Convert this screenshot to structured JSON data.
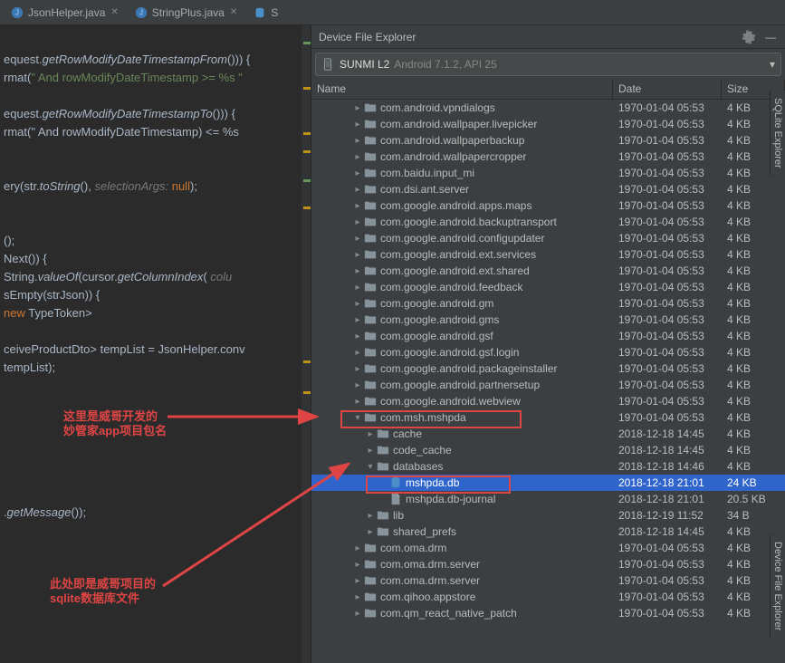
{
  "tabs": [
    {
      "label": "JsonHelper.java",
      "icon": "java"
    },
    {
      "label": "StringPlus.java",
      "icon": "java"
    },
    {
      "label": "S",
      "icon": "db"
    }
  ],
  "panel": {
    "title": "Device File Explorer",
    "device": "SUNMI L2",
    "device_detail": "Android 7.1.2, API 25"
  },
  "columns": {
    "name": "Name",
    "date": "Date",
    "size": "Size"
  },
  "annotations": {
    "a1_l1": "这里是威哥开发的",
    "a1_l2": "妙管家app项目包名",
    "a2_l1": "此处即是威哥项目的",
    "a2_l2": "sqlite数据库文件"
  },
  "side_tabs": {
    "sqlite": "SQLite Explorer",
    "dfe": "Device File Explorer"
  },
  "code": [
    "",
    "equest.getRowModifyDateTimestampFrom())) {",
    "rmat(\" And rowModifyDateTimestamp >= %s \"",
    "",
    "equest.getRowModifyDateTimestampTo())) {",
    "rmat(\" And rowModifyDateTimestamp) <= %s",
    "",
    "",
    "ery(str.toString(),  selectionArgs: null);",
    "",
    "",
    "<ShiftReceiveProductDto>();",
    "Next()) {",
    " String.valueOf(cursor.getColumnIndex( colu",
    "sEmpty(strJson)) {",
    " new TypeToken<List<ShiftReceiveProductDto>>",
    "",
    "ceiveProductDto> tempList = JsonHelper.conv",
    "tempList);",
    "",
    "",
    "",
    "",
    "",
    "",
    "",
    ".getMessage());",
    ""
  ],
  "files": [
    {
      "depth": 3,
      "arrow": "r",
      "icon": "folder",
      "name": "com.android.vpndialogs",
      "date": "1970-01-04 05:53",
      "size": "4 KB"
    },
    {
      "depth": 3,
      "arrow": "r",
      "icon": "folder",
      "name": "com.android.wallpaper.livepicker",
      "date": "1970-01-04 05:53",
      "size": "4 KB"
    },
    {
      "depth": 3,
      "arrow": "r",
      "icon": "folder",
      "name": "com.android.wallpaperbackup",
      "date": "1970-01-04 05:53",
      "size": "4 KB"
    },
    {
      "depth": 3,
      "arrow": "r",
      "icon": "folder",
      "name": "com.android.wallpapercropper",
      "date": "1970-01-04 05:53",
      "size": "4 KB"
    },
    {
      "depth": 3,
      "arrow": "r",
      "icon": "folder",
      "name": "com.baidu.input_mi",
      "date": "1970-01-04 05:53",
      "size": "4 KB"
    },
    {
      "depth": 3,
      "arrow": "r",
      "icon": "folder",
      "name": "com.dsi.ant.server",
      "date": "1970-01-04 05:53",
      "size": "4 KB"
    },
    {
      "depth": 3,
      "arrow": "r",
      "icon": "folder",
      "name": "com.google.android.apps.maps",
      "date": "1970-01-04 05:53",
      "size": "4 KB"
    },
    {
      "depth": 3,
      "arrow": "r",
      "icon": "folder",
      "name": "com.google.android.backuptransport",
      "date": "1970-01-04 05:53",
      "size": "4 KB"
    },
    {
      "depth": 3,
      "arrow": "r",
      "icon": "folder",
      "name": "com.google.android.configupdater",
      "date": "1970-01-04 05:53",
      "size": "4 KB"
    },
    {
      "depth": 3,
      "arrow": "r",
      "icon": "folder",
      "name": "com.google.android.ext.services",
      "date": "1970-01-04 05:53",
      "size": "4 KB"
    },
    {
      "depth": 3,
      "arrow": "r",
      "icon": "folder",
      "name": "com.google.android.ext.shared",
      "date": "1970-01-04 05:53",
      "size": "4 KB"
    },
    {
      "depth": 3,
      "arrow": "r",
      "icon": "folder",
      "name": "com.google.android.feedback",
      "date": "1970-01-04 05:53",
      "size": "4 KB"
    },
    {
      "depth": 3,
      "arrow": "r",
      "icon": "folder",
      "name": "com.google.android.gm",
      "date": "1970-01-04 05:53",
      "size": "4 KB"
    },
    {
      "depth": 3,
      "arrow": "r",
      "icon": "folder",
      "name": "com.google.android.gms",
      "date": "1970-01-04 05:53",
      "size": "4 KB"
    },
    {
      "depth": 3,
      "arrow": "r",
      "icon": "folder",
      "name": "com.google.android.gsf",
      "date": "1970-01-04 05:53",
      "size": "4 KB"
    },
    {
      "depth": 3,
      "arrow": "r",
      "icon": "folder",
      "name": "com.google.android.gsf.login",
      "date": "1970-01-04 05:53",
      "size": "4 KB"
    },
    {
      "depth": 3,
      "arrow": "r",
      "icon": "folder",
      "name": "com.google.android.packageinstaller",
      "date": "1970-01-04 05:53",
      "size": "4 KB"
    },
    {
      "depth": 3,
      "arrow": "r",
      "icon": "folder",
      "name": "com.google.android.partnersetup",
      "date": "1970-01-04 05:53",
      "size": "4 KB"
    },
    {
      "depth": 3,
      "arrow": "r",
      "icon": "folder",
      "name": "com.google.android.webview",
      "date": "1970-01-04 05:53",
      "size": "4 KB"
    },
    {
      "depth": 3,
      "arrow": "d",
      "icon": "folder",
      "name": "com.msh.mshpda",
      "date": "1970-01-04 05:53",
      "size": "4 KB",
      "boxed": 1
    },
    {
      "depth": 4,
      "arrow": "r",
      "icon": "folder",
      "name": "cache",
      "date": "2018-12-18 14:45",
      "size": "4 KB"
    },
    {
      "depth": 4,
      "arrow": "r",
      "icon": "folder",
      "name": "code_cache",
      "date": "2018-12-18 14:45",
      "size": "4 KB"
    },
    {
      "depth": 4,
      "arrow": "d",
      "icon": "folder",
      "name": "databases",
      "date": "2018-12-18 14:46",
      "size": "4 KB"
    },
    {
      "depth": 5,
      "arrow": "",
      "icon": "db",
      "name": "mshpda.db",
      "date": "2018-12-18 21:01",
      "size": "24 KB",
      "selected": true,
      "boxed": 2
    },
    {
      "depth": 5,
      "arrow": "",
      "icon": "file",
      "name": "mshpda.db-journal",
      "date": "2018-12-18 21:01",
      "size": "20.5 KB"
    },
    {
      "depth": 4,
      "arrow": "r",
      "icon": "folder",
      "name": "lib",
      "date": "2018-12-19 11:52",
      "size": "34 B"
    },
    {
      "depth": 4,
      "arrow": "r",
      "icon": "folder",
      "name": "shared_prefs",
      "date": "2018-12-18 14:45",
      "size": "4 KB"
    },
    {
      "depth": 3,
      "arrow": "r",
      "icon": "folder",
      "name": "com.oma.drm",
      "date": "1970-01-04 05:53",
      "size": "4 KB"
    },
    {
      "depth": 3,
      "arrow": "r",
      "icon": "folder",
      "name": "com.oma.drm.server",
      "date": "1970-01-04 05:53",
      "size": "4 KB"
    },
    {
      "depth": 3,
      "arrow": "r",
      "icon": "folder",
      "name": "com.oma.drm.server",
      "date": "1970-01-04 05:53",
      "size": "4 KB"
    },
    {
      "depth": 3,
      "arrow": "r",
      "icon": "folder",
      "name": "com.qihoo.appstore",
      "date": "1970-01-04 05:53",
      "size": "4 KB"
    },
    {
      "depth": 3,
      "arrow": "r",
      "icon": "folder",
      "name": "com.qm_react_native_patch",
      "date": "1970-01-04 05:53",
      "size": "4 KB"
    }
  ]
}
